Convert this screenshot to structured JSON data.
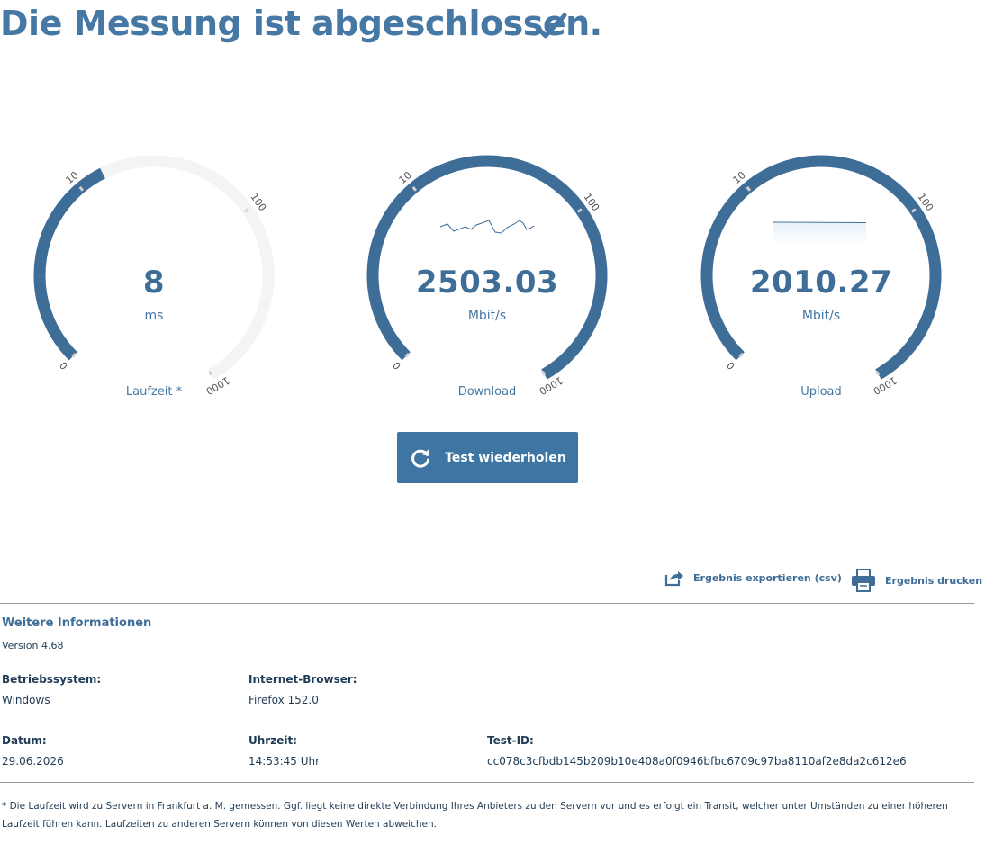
{
  "header": {
    "title": "Die Messung ist abgeschlossen.",
    "check_icon": "check-icon"
  },
  "colors": {
    "accent": "#4578a4",
    "gauge_fill": "#3e6d97",
    "gauge_track": "#f4f4f4",
    "button": "#3e75a2"
  },
  "gauges": [
    {
      "name": "latency",
      "value": "8",
      "unit": "ms",
      "label": "Laufzeit *",
      "ticks": [
        "0",
        "10",
        "100",
        "1000"
      ],
      "level": 0.38
    },
    {
      "name": "download",
      "value": "2503.03",
      "unit": "Mbit/s",
      "label": "Download",
      "ticks": [
        "0",
        "10",
        "100",
        "1000"
      ],
      "level": 1.0
    },
    {
      "name": "upload",
      "value": "2010.27",
      "unit": "Mbit/s",
      "label": "Upload",
      "ticks": [
        "0",
        "10",
        "100",
        "1000"
      ],
      "level": 1.0
    }
  ],
  "repeat_button": {
    "label": "Test wiederholen",
    "icon": "refresh-icon"
  },
  "actions": {
    "export_label": "Ergebnis exportieren (csv)",
    "export_icon": "export-icon",
    "print_label": "Ergebnis drucken",
    "print_icon": "printer-icon"
  },
  "info": {
    "title": "Weitere Informationen",
    "version": "Version 4.68",
    "os_label": "Betriebssystem:",
    "os_value": "Windows",
    "browser_label": "Internet-Browser:",
    "browser_value": "Firefox 152.0",
    "date_label": "Datum:",
    "date_value": "29.06.2026",
    "time_label": "Uhrzeit:",
    "time_value": "14:53:45 Uhr",
    "testid_label": "Test-ID:",
    "testid_value": "cc078c3cfbdb145b209b10e408a0f0946bfbc6709c97ba8110af2e8da2c612e6"
  },
  "footnote": "* Die Laufzeit wird zu Servern in Frankfurt a. M. gemessen. Ggf. liegt keine direkte Verbindung Ihres Anbieters zu den Servern vor und es erfolgt ein Transit, welcher unter Umständen zu einer höheren Laufzeit führen kann. Laufzeiten zu anderen Servern können von diesen Werten abweichen."
}
